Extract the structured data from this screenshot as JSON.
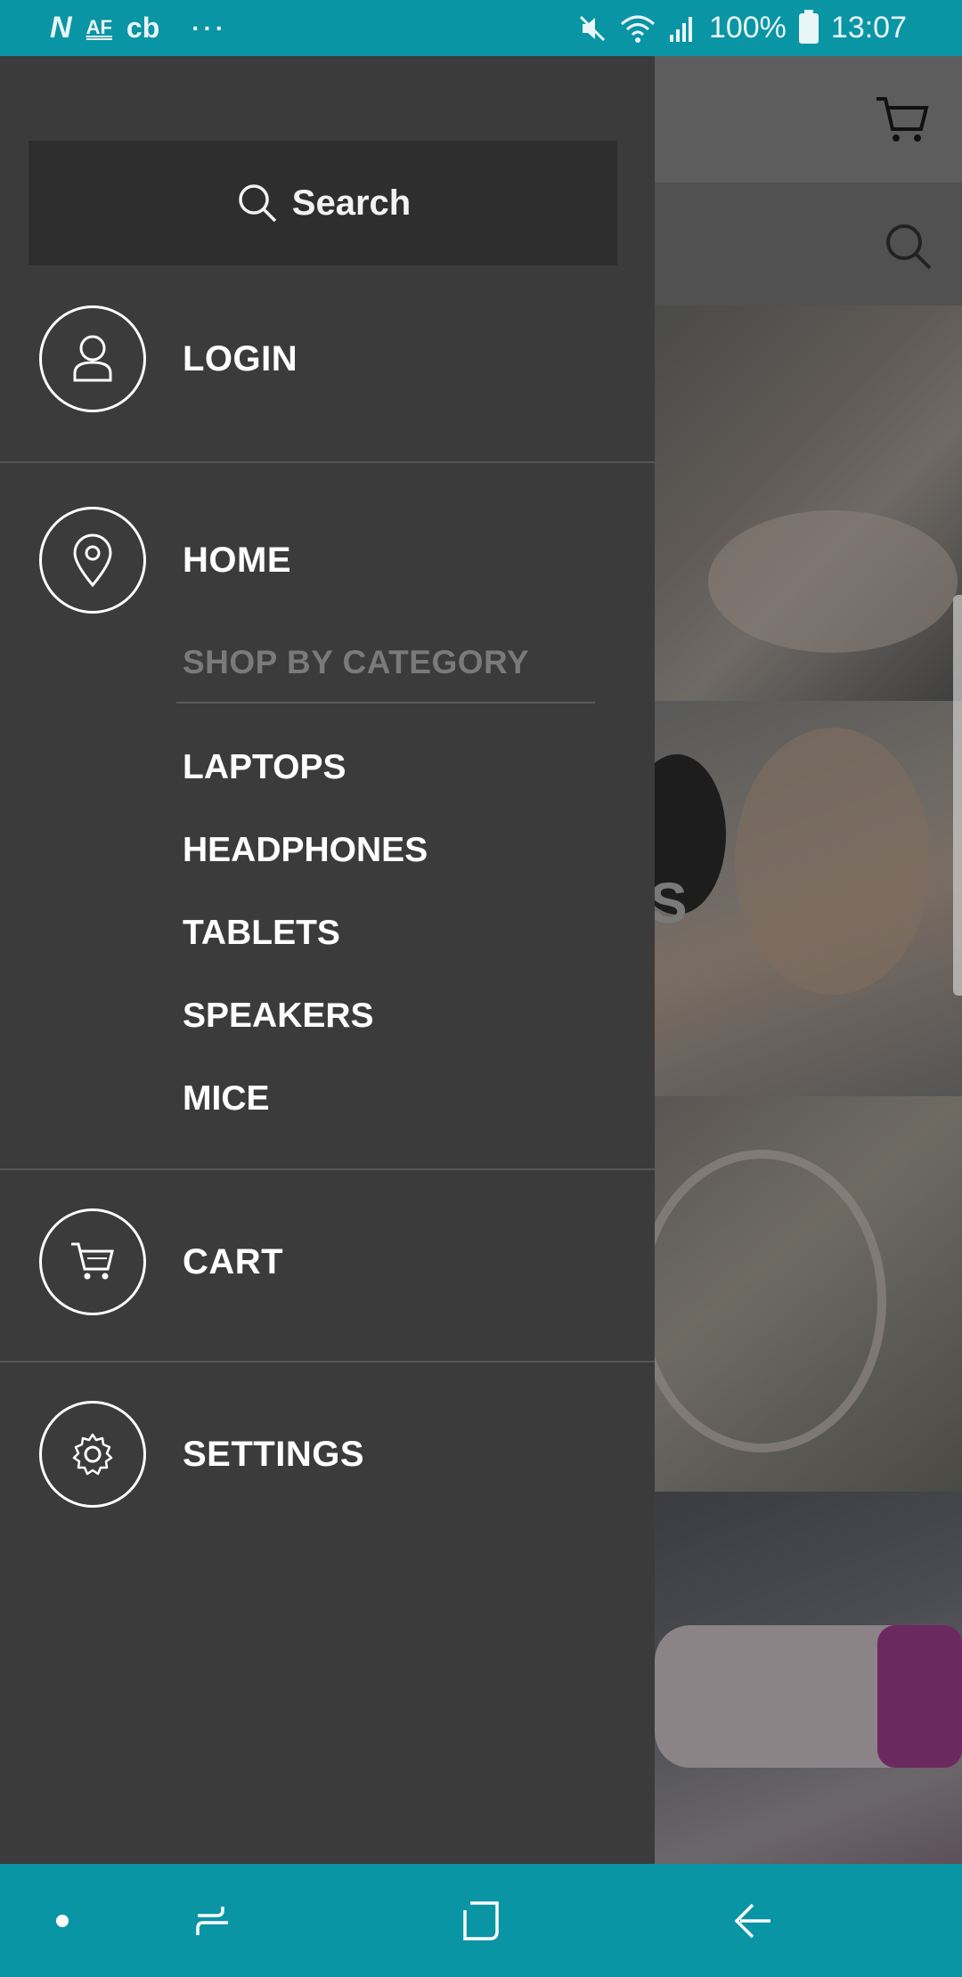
{
  "status_bar": {
    "left_icons": [
      "N",
      "AF",
      "cb"
    ],
    "dots": "···",
    "battery": "100%",
    "time": "13:07",
    "icons": [
      "mute-icon",
      "wifi-icon",
      "signal-icon",
      "battery-icon"
    ]
  },
  "drawer": {
    "search_label": "Search",
    "menu": {
      "login": "LOGIN",
      "home": "HOME",
      "cart": "CART",
      "settings": "SETTINGS"
    },
    "category_header": "SHOP BY CATEGORY",
    "categories": [
      "LAPTOPS",
      "HEADPHONES",
      "TABLETS",
      "SPEAKERS",
      "MICE"
    ]
  },
  "background": {
    "tile_letter": "S"
  },
  "colors": {
    "accent": "#0a95a5",
    "drawer_bg": "#3b3b3b",
    "search_bg": "#2e2e2e",
    "muted_text": "#7a7a7a"
  }
}
